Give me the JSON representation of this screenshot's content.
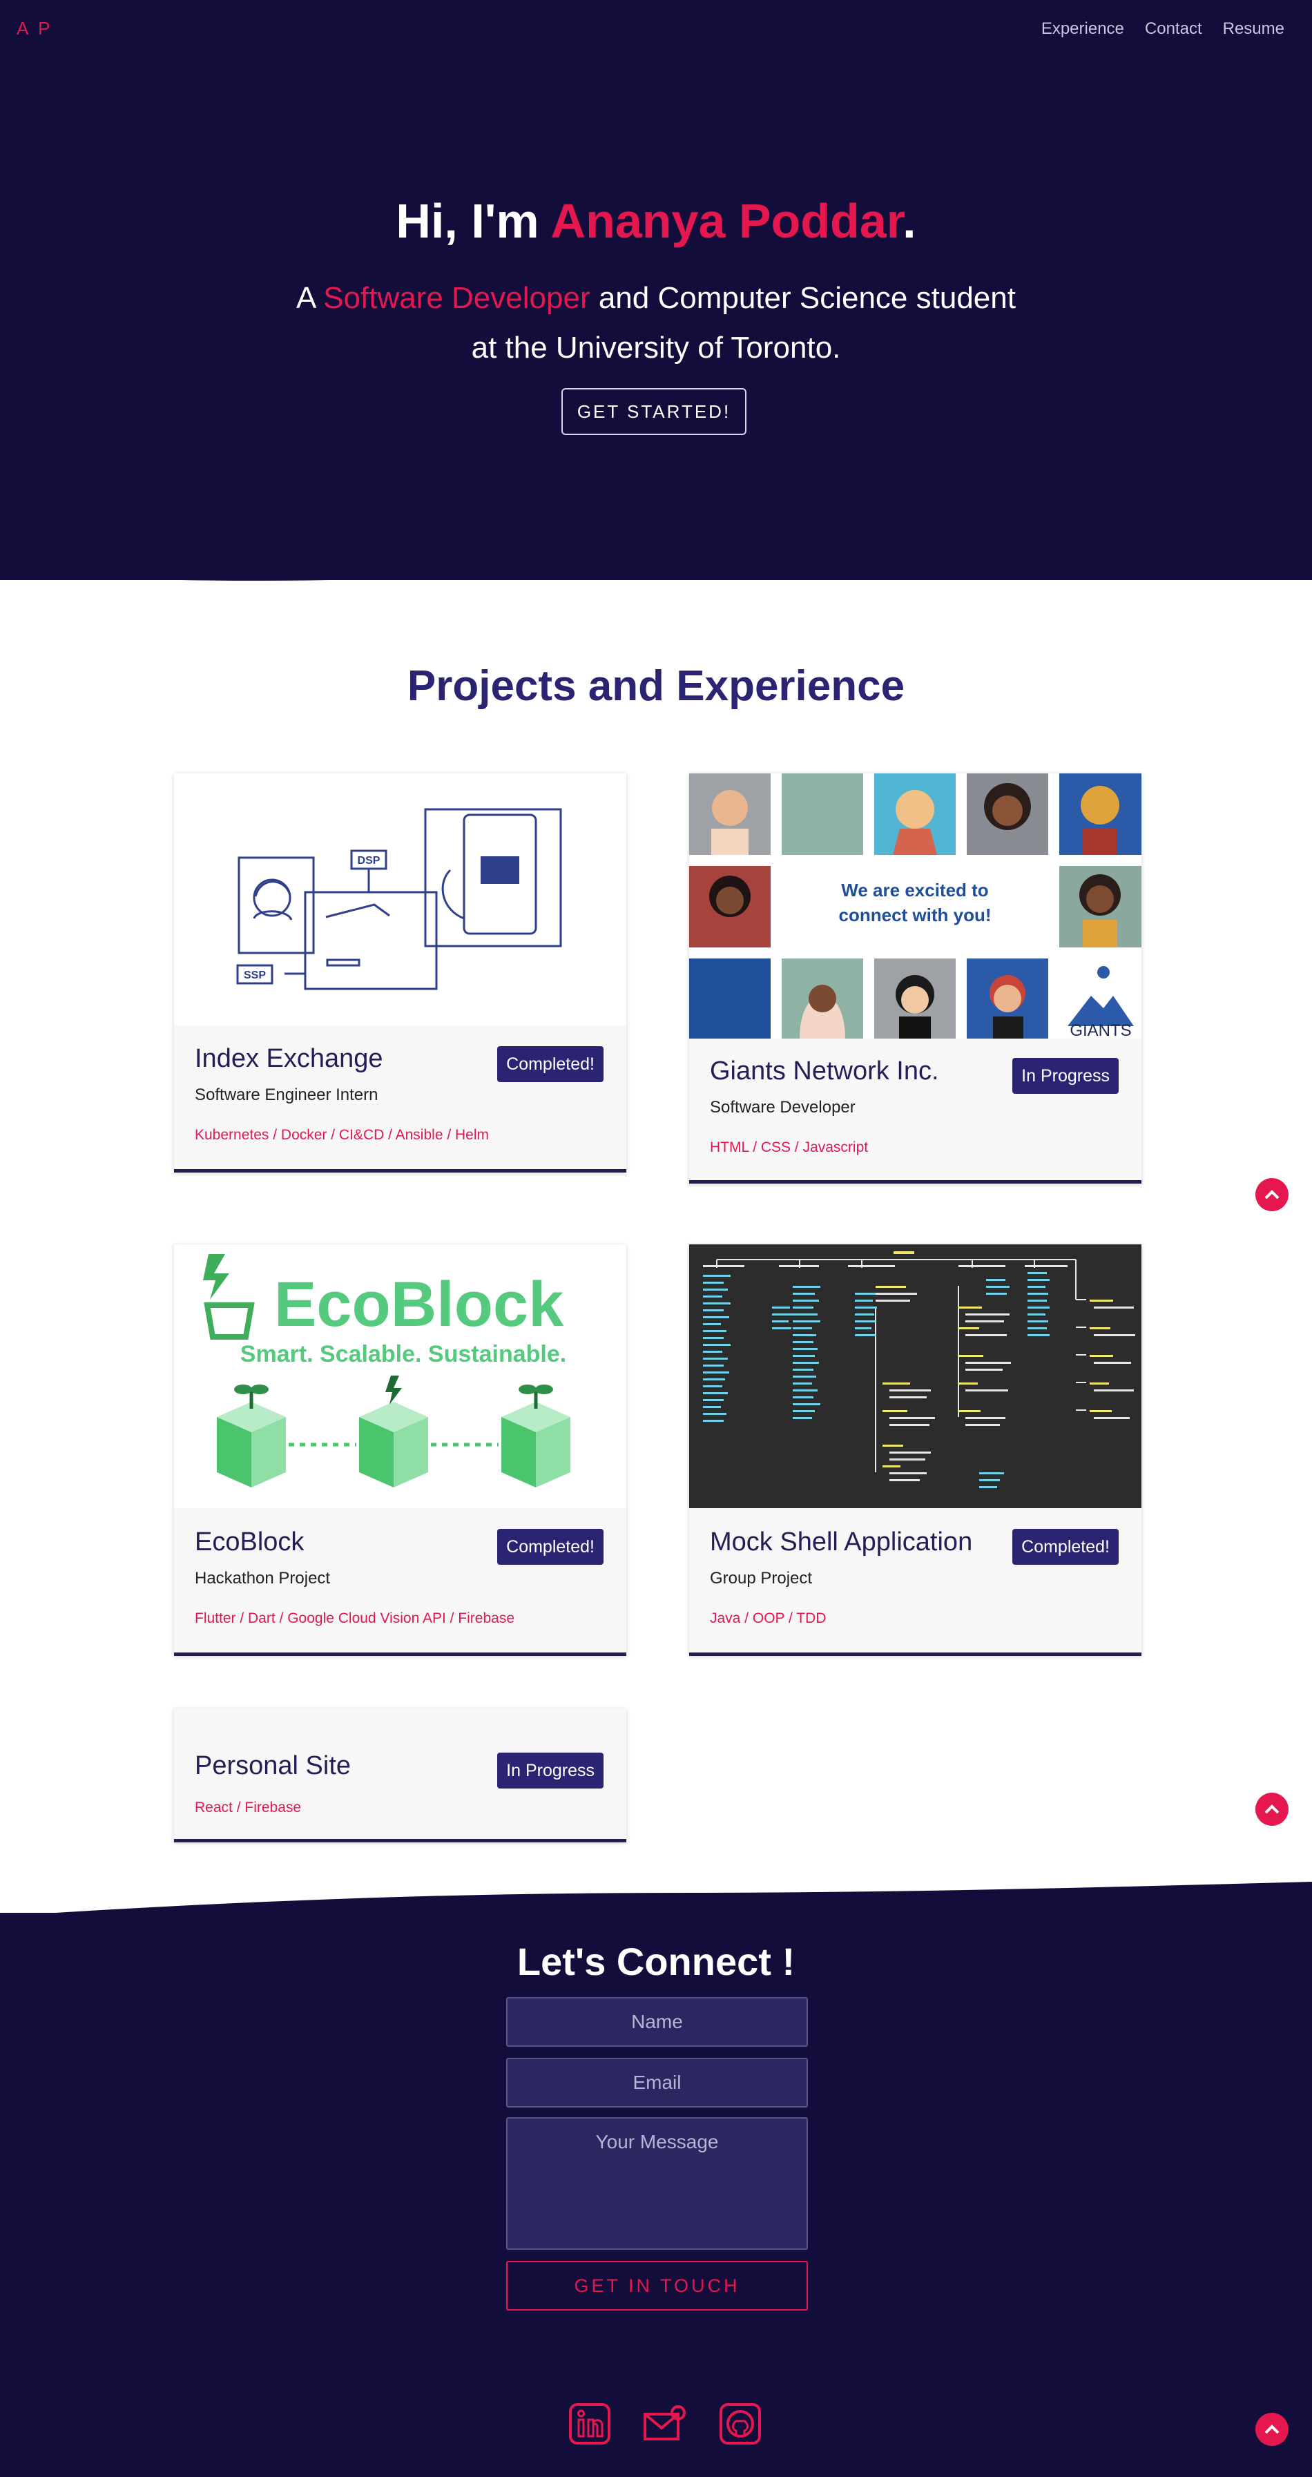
{
  "nav": {
    "logo": "A P",
    "links": [
      "Experience",
      "Contact",
      "Resume"
    ]
  },
  "hero": {
    "greeting": "Hi, I'm ",
    "name": "Ananya Poddar",
    "name_end": ".",
    "sub_prefix": "A ",
    "role": "Software Developer",
    "sub_rest_1": " and Computer Science student",
    "sub_rest_2": "at the University of Toronto.",
    "cta": "GET STARTED!"
  },
  "projects": {
    "title": "Projects and Experience",
    "items": [
      {
        "name": "Index Exchange",
        "role": "Software Engineer Intern",
        "tags": "Kubernetes / Docker / CI&CD / Ansible / Helm",
        "status": "Completed!"
      },
      {
        "name": "Giants Network Inc.",
        "role": "Software Developer",
        "tags": "HTML / CSS / Javascript",
        "status": "In Progress",
        "image_text_1": "We are excited to",
        "image_text_2": "connect with you!",
        "image_logo": "GIANTS"
      },
      {
        "name": "EcoBlock",
        "role": "Hackathon Project",
        "tags": "Flutter / Dart / Google Cloud Vision API / Firebase",
        "status": "Completed!",
        "image_text_1": "EcoBlock",
        "image_text_2": "Smart. Scalable. Sustainable."
      },
      {
        "name": "Mock Shell Application",
        "role": "Group Project",
        "tags": "Java / OOP / TDD",
        "status": "Completed!"
      },
      {
        "name": "Personal Site",
        "tags": "React / Firebase",
        "status": "In Progress"
      }
    ],
    "index_labels": {
      "dsp": "DSP",
      "ssp": "SSP"
    }
  },
  "connect": {
    "title": "Let's Connect !",
    "name_placeholder": "Name",
    "email_placeholder": "Email",
    "message_placeholder": "Your Message",
    "submit": "GET IN TOUCH"
  },
  "icons": {
    "scroll_top": "chevron-up-icon",
    "social": [
      "linkedin-icon",
      "mail-icon",
      "github-icon"
    ]
  },
  "colors": {
    "navy": "#120d3a",
    "accent": "#e5174f",
    "card_title": "#231f56"
  }
}
